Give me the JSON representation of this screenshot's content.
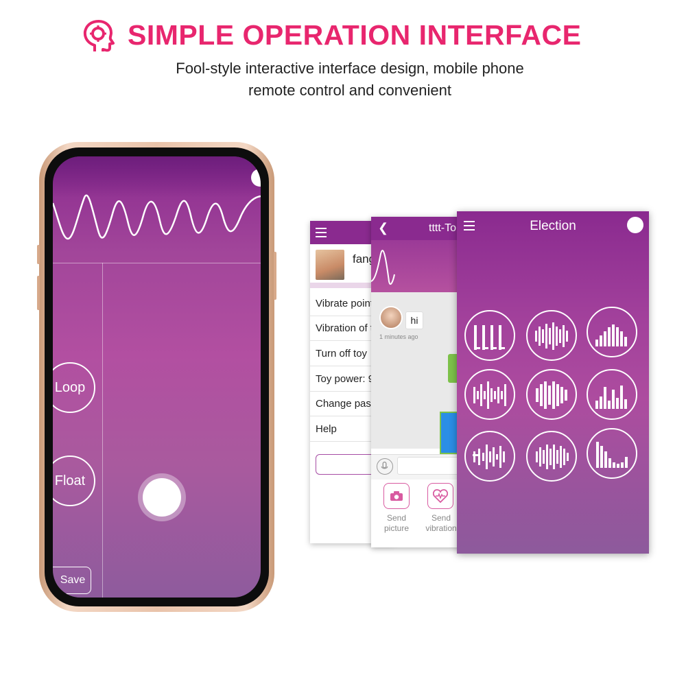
{
  "header": {
    "title": "SIMPLE OPERATION INTERFACE",
    "subtitle_line1": "Fool-style interactive interface design, mobile phone",
    "subtitle_line2": "remote control and convenient",
    "icon": "head-gear-icon",
    "accent_color": "#e8266e"
  },
  "main_phone": {
    "modes": {
      "loop": "Loop",
      "float": "Float"
    },
    "save_label": "Save",
    "theme_color": "#8a2a8f"
  },
  "settings_screen": {
    "user_name": "fang",
    "rows": [
      "Vibrate point",
      "Vibration of t",
      "Turn off toy",
      "Toy power:  9",
      "Change pass",
      "Help"
    ]
  },
  "chat_screen": {
    "title": "tttt-To",
    "message": "hi",
    "timestamp": "1 minutes ago",
    "tools": [
      {
        "label_line1": "Send",
        "label_line2": "picture",
        "icon": "camera-icon"
      },
      {
        "label_line1": "Send",
        "label_line2": "vibration",
        "icon": "heart-wave-icon"
      }
    ]
  },
  "election_screen": {
    "title": "Election",
    "patterns": [
      "pattern-1",
      "pattern-2",
      "pattern-3",
      "pattern-4",
      "pattern-5",
      "pattern-6",
      "pattern-7",
      "pattern-8",
      "pattern-9"
    ]
  }
}
